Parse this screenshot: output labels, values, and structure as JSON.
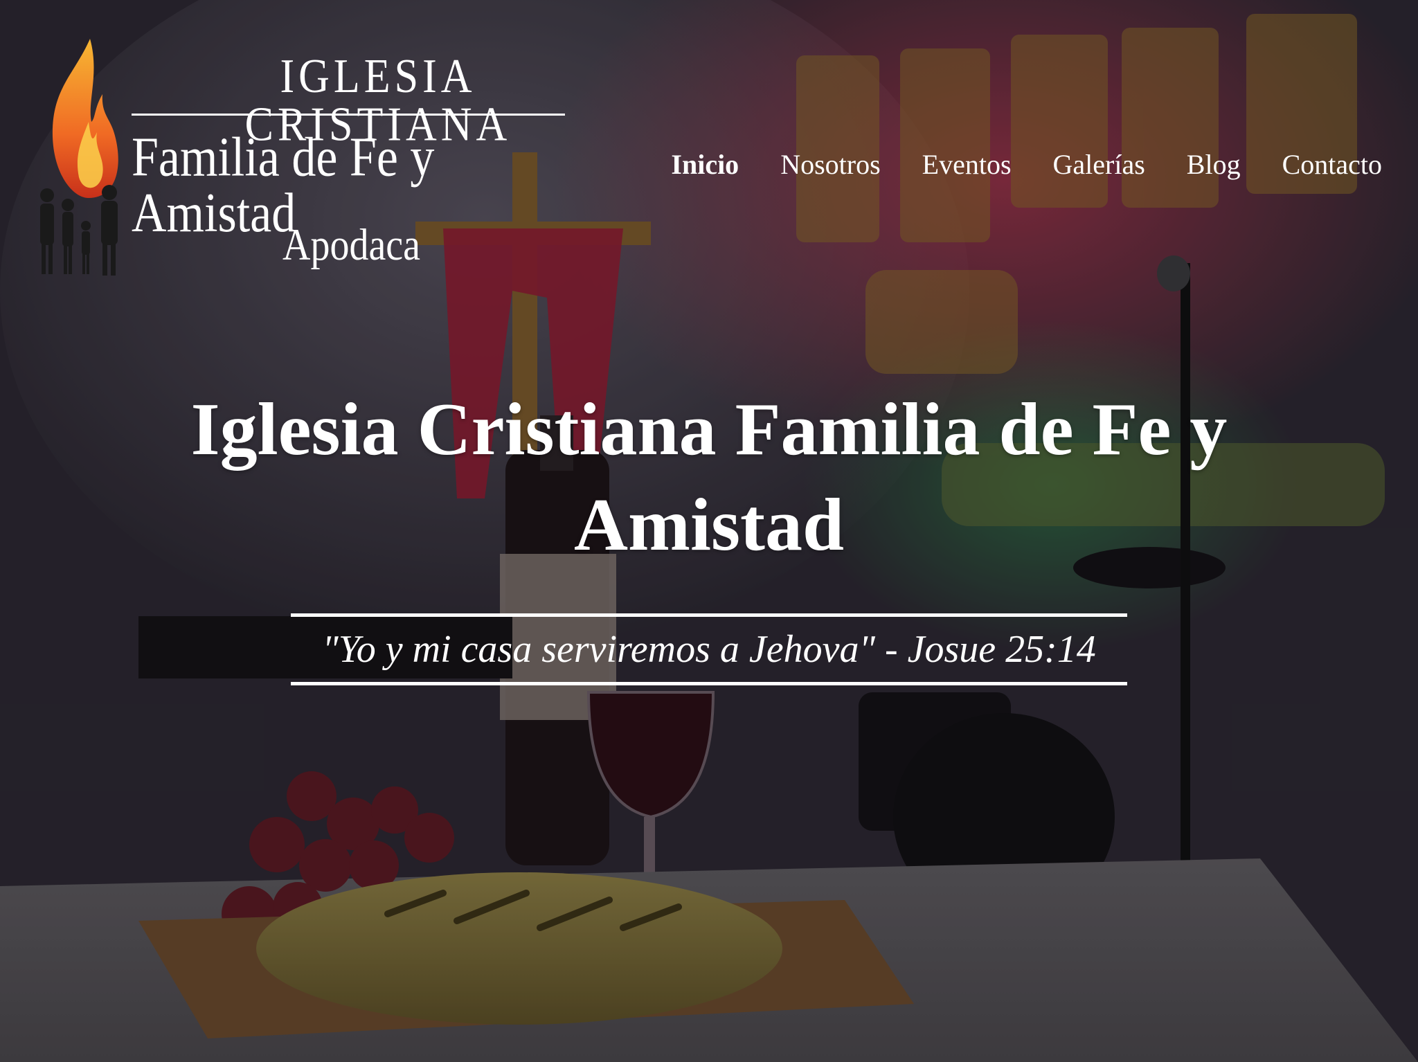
{
  "logo": {
    "line1": "IGLESIA CRISTIANA",
    "line2": "Familia de Fe y Amistad",
    "line3": "Apodaca"
  },
  "nav": {
    "items": [
      {
        "label": "Inicio",
        "active": true
      },
      {
        "label": "Nosotros",
        "active": false
      },
      {
        "label": "Eventos",
        "active": false
      },
      {
        "label": "Galerías",
        "active": false
      },
      {
        "label": "Blog",
        "active": false
      },
      {
        "label": "Contacto",
        "active": false
      }
    ]
  },
  "hero": {
    "title_line1": "Iglesia Cristiana Familia de Fe y",
    "title_line2": "Amistad",
    "verse": "\"Yo y mi casa serviremos a Jehova\" - Josue 25:14"
  },
  "colors": {
    "text": "#ffffff",
    "flame_top": "#f7b733",
    "flame_bottom": "#e2401c"
  }
}
